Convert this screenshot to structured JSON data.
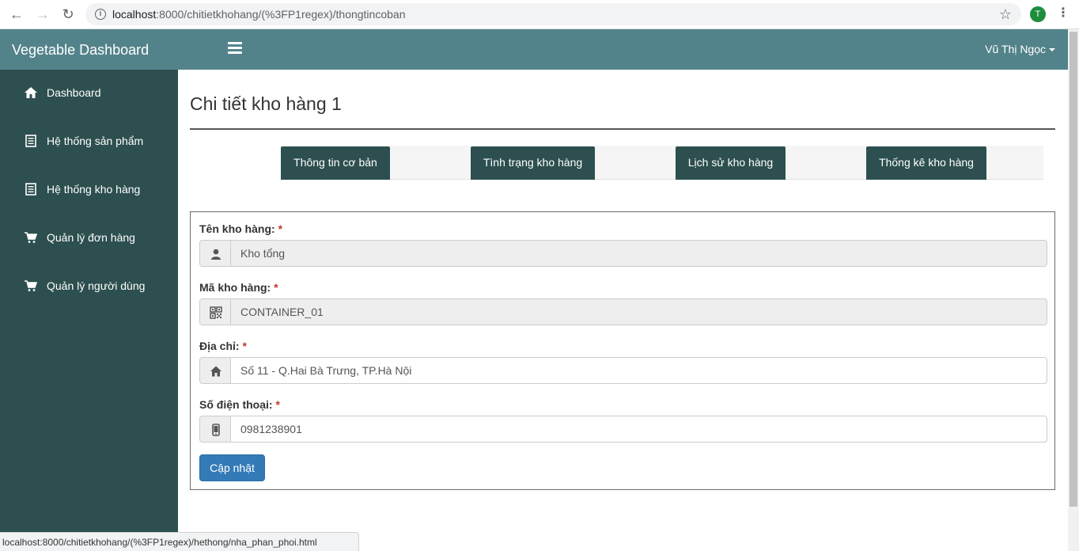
{
  "browser": {
    "url_host": "localhost",
    "url_rest": ":8000/chitietkhohang/(%3FP1regex)/thongtincoban",
    "profile_initial": "T",
    "status_link": "localhost:8000/chitietkhohang/(%3FP1regex)/hethong/nha_phan_phoi.html"
  },
  "app": {
    "brand": "Vegetable Dashboard",
    "user": "Vũ Thị Ngọc",
    "colors": {
      "topbar": "#53838a",
      "sidebar": "#2d4f4f",
      "primary_button": "#337ab7"
    }
  },
  "sidebar": {
    "items": [
      {
        "label": "Dashboard",
        "icon": "home-icon"
      },
      {
        "label": "Hệ thống sản phẩm",
        "icon": "list-icon"
      },
      {
        "label": "Hệ thống kho hàng",
        "icon": "list-icon"
      },
      {
        "label": "Quản lý đơn hàng",
        "icon": "cart-icon"
      },
      {
        "label": "Quản lý người dùng",
        "icon": "cart-icon"
      }
    ]
  },
  "main": {
    "title": "Chi tiết kho hàng 1",
    "tabs": [
      {
        "label": "Thông tin cơ bản"
      },
      {
        "label": "Tình trạng kho hàng"
      },
      {
        "label": "Lịch sử kho hàng"
      },
      {
        "label": "Thống kê kho hàng"
      }
    ],
    "form": {
      "required_mark": "*",
      "fields": [
        {
          "label": "Tên kho hàng:",
          "value": "Kho tổng",
          "icon": "user-icon",
          "readonly": true
        },
        {
          "label": "Mã kho hàng:",
          "value": "CONTAINER_01",
          "icon": "qrcode-icon",
          "readonly": true
        },
        {
          "label": "Địa chỉ:",
          "value": "Số 11 - Q.Hai Bà Trưng, TP.Hà Nội",
          "icon": "home-icon",
          "readonly": false
        },
        {
          "label": "Số điện thoại:",
          "value": "0981238901",
          "icon": "phone-icon",
          "readonly": false
        }
      ],
      "submit_label": "Cập nhật"
    }
  }
}
